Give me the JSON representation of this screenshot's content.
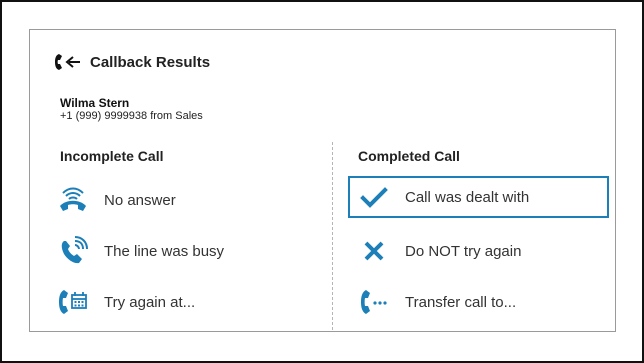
{
  "header": {
    "title": "Callback Results",
    "icon": "phone-incoming-icon"
  },
  "contact": {
    "name": "Wilma Stern",
    "detail": "+1 (999) 9999938 from Sales"
  },
  "incomplete": {
    "heading": "Incomplete Call",
    "options": [
      {
        "label": "No answer",
        "icon": "hangup-icon"
      },
      {
        "label": "The line was busy",
        "icon": "busy-phone-icon"
      },
      {
        "label": "Try again at...",
        "icon": "phone-calendar-icon"
      }
    ]
  },
  "completed": {
    "heading": "Completed Call",
    "options": [
      {
        "label": "Call was dealt with",
        "icon": "checkmark-icon",
        "selected": true
      },
      {
        "label": "Do NOT try again",
        "icon": "x-icon"
      },
      {
        "label": "Transfer call to...",
        "icon": "phone-transfer-icon"
      }
    ]
  },
  "colors": {
    "accent": "#1c7fb8",
    "text": "#333333",
    "border": "#9a9a9a"
  }
}
